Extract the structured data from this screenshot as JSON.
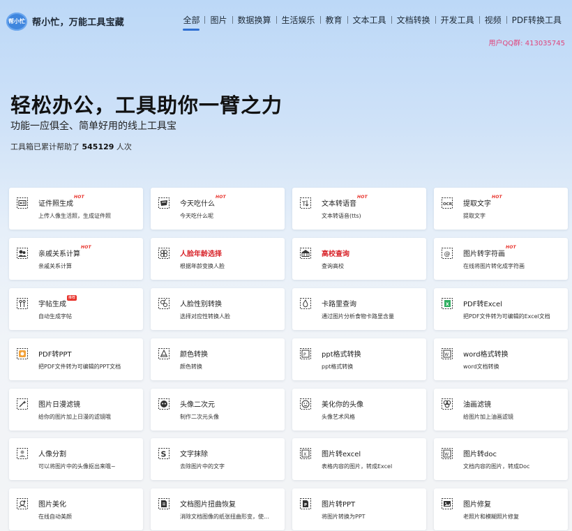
{
  "header": {
    "logo_badge": "帮小忙",
    "logo_text": "帮小忙，万能工具宝藏",
    "nav": [
      "全部",
      "图片",
      "数据换算",
      "生活娱乐",
      "教育",
      "文本工具",
      "文档转换",
      "开发工具",
      "视频",
      "PDF转换工具"
    ],
    "active_nav": "全部",
    "qq_text": "用户QQ群: 413035745"
  },
  "hero": {
    "title": "轻松办公，工具助你一臂之力",
    "subtitle": "功能一应俱全、简单好用的线上工具宝",
    "count_prefix": "工具箱已累计帮助了 ",
    "count_value": "545129",
    "count_suffix": " 人次"
  },
  "colors": {
    "accent": "#2f6fd1",
    "hot": "#e8322b",
    "qq": "#e0457c",
    "highlight_title": "#d8242a"
  },
  "tools": [
    {
      "title": "证件照生成",
      "desc": "上传人像生活照，生成证件照",
      "badge": "HOT",
      "icon": "id-card-icon"
    },
    {
      "title": "今天吃什么",
      "desc": "今天吃什么呢",
      "badge": "HOT",
      "icon": "food-icon"
    },
    {
      "title": "文本转语音",
      "desc": "文本转语音(tts)",
      "badge": "HOT",
      "icon": "text-to-speech-icon"
    },
    {
      "title": "提取文字",
      "desc": "提取文字",
      "badge": "HOT",
      "icon": "ocr-icon"
    },
    {
      "title": "亲戚关系计算",
      "desc": "亲戚关系计算",
      "badge": "HOT",
      "icon": "relatives-icon"
    },
    {
      "title": "人脸年龄选择",
      "desc": "根据年龄变换人脸",
      "badge": "",
      "icon": "face-age-icon",
      "red": true
    },
    {
      "title": "高校查询",
      "desc": "查询高校",
      "badge": "",
      "icon": "school-icon",
      "red": true
    },
    {
      "title": "图片转字符画",
      "desc": "在线将图片转化成字符画",
      "badge": "HOT",
      "icon": "char-art-icon"
    },
    {
      "title": "字帖生成",
      "desc": "自动生成字帖",
      "badge": "推荐",
      "icon": "copybook-icon"
    },
    {
      "title": "人脸性别转换",
      "desc": "选择对应性转换人脸",
      "badge": "",
      "icon": "gender-swap-icon"
    },
    {
      "title": "卡路里查询",
      "desc": "通过图片分析食物卡路里含量",
      "badge": "",
      "icon": "calorie-icon"
    },
    {
      "title": "PDF转Excel",
      "desc": "把PDF文件转为可编辑的Excel文档",
      "badge": "",
      "icon": "pdf-excel-icon"
    },
    {
      "title": "PDF转PPT",
      "desc": "把PDF文件转为可编辑的PPT文档",
      "badge": "",
      "icon": "pdf-ppt-icon"
    },
    {
      "title": "颜色转换",
      "desc": "颜色转换",
      "badge": "",
      "icon": "color-icon"
    },
    {
      "title": "ppt格式转换",
      "desc": "ppt格式转换",
      "badge": "",
      "icon": "ppt-format-icon"
    },
    {
      "title": "word格式转换",
      "desc": "word文档转换",
      "badge": "",
      "icon": "word-format-icon"
    },
    {
      "title": "图片日漫滤镜",
      "desc": "给你的图片加上日漫的滤镜哦",
      "badge": "",
      "icon": "anime-filter-icon"
    },
    {
      "title": "头像二次元",
      "desc": "制作二次元头像",
      "badge": "",
      "icon": "anime-avatar-icon"
    },
    {
      "title": "美化你的头像",
      "desc": "头像艺术风格",
      "badge": "",
      "icon": "avatar-art-icon"
    },
    {
      "title": "油画滤镜",
      "desc": "给图片加上油画滤镜",
      "badge": "",
      "icon": "oil-paint-icon"
    },
    {
      "title": "人像分割",
      "desc": "可以将图片中的头像抠出来哦~",
      "badge": "",
      "icon": "portrait-cutout-icon"
    },
    {
      "title": "文字抹除",
      "desc": "去除图片中的文字",
      "badge": "",
      "icon": "text-erase-icon"
    },
    {
      "title": "图片转excel",
      "desc": "表格内容的图片，转成Excel",
      "badge": "",
      "icon": "image-excel-icon"
    },
    {
      "title": "图片转doc",
      "desc": "文档内容的图片，转成Doc",
      "badge": "",
      "icon": "image-doc-icon"
    },
    {
      "title": "图片美化",
      "desc": "在线自动美颜",
      "badge": "",
      "icon": "beautify-icon"
    },
    {
      "title": "文档图片扭曲恢复",
      "desc": "消除文档图像的纸张扭曲形变，使...",
      "badge": "",
      "icon": "doc-unwarp-icon"
    },
    {
      "title": "图片转PPT",
      "desc": "将图片转换为PPT",
      "badge": "",
      "icon": "image-ppt-icon"
    },
    {
      "title": "图片修复",
      "desc": "老照片和模糊照片修复",
      "badge": "",
      "icon": "image-repair-icon"
    }
  ]
}
